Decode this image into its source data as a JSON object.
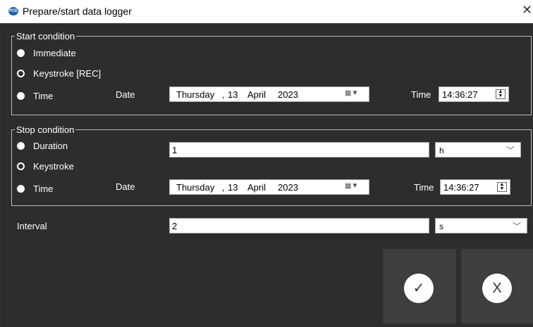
{
  "window": {
    "title": "Prepare/start data logger",
    "icon": "pce-logo-icon"
  },
  "start": {
    "legend": "Start condition",
    "options": [
      "Immediate",
      "Keystroke [REC]",
      "Time"
    ],
    "date_label": "Date",
    "date": {
      "weekday": "Thursday",
      "sep": ",",
      "day": "13",
      "month": "April",
      "year": "2023"
    },
    "time_label": "Time",
    "time": "14:36:27"
  },
  "stop": {
    "legend": "Stop condition",
    "options": [
      "Duration",
      "Keystroke",
      "Time"
    ],
    "duration_value": "1",
    "duration_unit": "h",
    "date_label": "Date",
    "date": {
      "weekday": "Thursday",
      "sep": ",",
      "day": "13",
      "month": "April",
      "year": "2023"
    },
    "time_label": "Time",
    "time": "14:36:27"
  },
  "interval": {
    "label": "Interval",
    "value": "2",
    "unit": "s"
  },
  "buttons": {
    "ok_icon": "checkmark-icon",
    "cancel_label": "X"
  },
  "colors": {
    "background": "#2d2d2d",
    "button": "#3e3e3e",
    "titlebar": "#ffffff"
  }
}
